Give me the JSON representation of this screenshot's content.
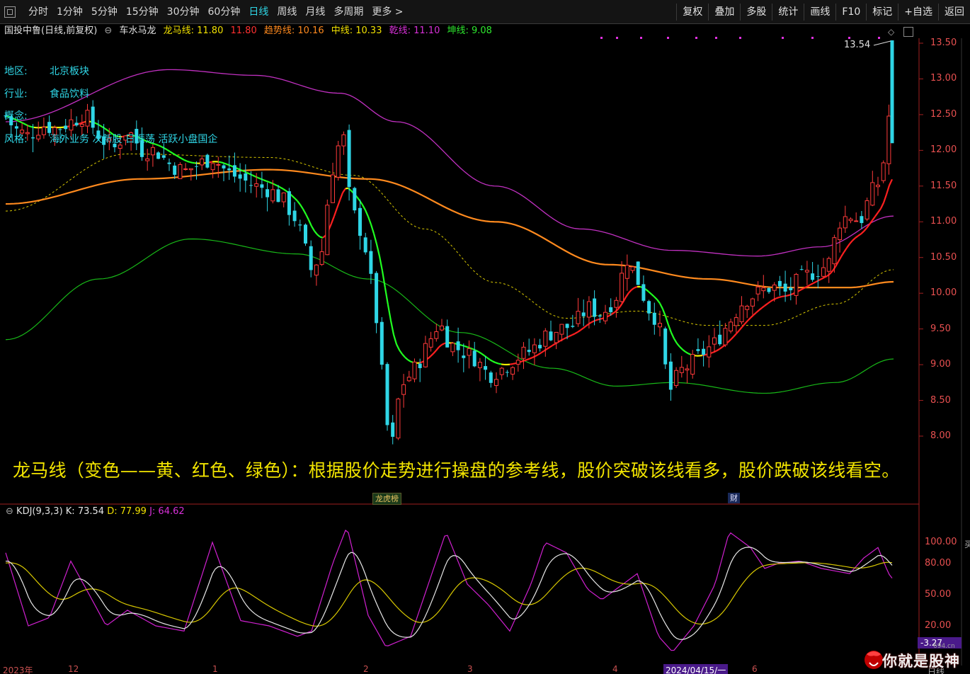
{
  "toolbar": {
    "periods": [
      "分时",
      "1分钟",
      "5分钟",
      "15分钟",
      "30分钟",
      "60分钟",
      "日线",
      "周线",
      "月线",
      "多周期",
      "更多 >"
    ],
    "active_period": "日线",
    "tools": [
      "复权",
      "叠加",
      "多股",
      "统计",
      "画线",
      "F10",
      "标记",
      "+自选",
      "返回"
    ]
  },
  "info": {
    "stock": "国投中鲁(日线,前复权)",
    "indicator_name": "车水马龙",
    "items": [
      {
        "label": "龙马线: 11.80",
        "color": "#f0e000"
      },
      {
        "label": "11.80",
        "color": "#ff3030"
      },
      {
        "label": "趋势线: 10.16",
        "color": "#ff8a1e"
      },
      {
        "label": "中线: 10.33",
        "color": "#f0e000"
      },
      {
        "label": "乾线: 11.10",
        "color": "#d830d8"
      },
      {
        "label": "坤线: 9.08",
        "color": "#2ee82e"
      }
    ]
  },
  "side": {
    "region_label": "地区:",
    "region_value": "北京板块",
    "industry_label": "行业:",
    "industry_value": "食品饮料",
    "concept_label": "概念:",
    "style_label": "风格:",
    "style_value": "海外业务 次新股 日振荡 活跃小盘国企"
  },
  "caption": "龙马线（变色——黄、红色、绿色）：根据股价走势进行操盘的参考线，股价突破该线看多，股价跌破该线看空。",
  "price_axis": [
    "13.50",
    "13.00",
    "12.50",
    "12.00",
    "11.50",
    "11.00",
    "10.50",
    "10.00",
    "9.50",
    "9.00",
    "8.50",
    "8.00"
  ],
  "max_price_label": "13.54",
  "kdj": {
    "label": "KDJ(9,3,3)",
    "k": "K: 73.54",
    "d": "D: 77.99",
    "j": "J: 64.62",
    "axis": [
      "100.00",
      "80.00",
      "50.00",
      "20.00"
    ],
    "current": "-3.27"
  },
  "badges": {
    "b1": "龙虎榜",
    "b2": "财"
  },
  "xaxis": [
    "2023年",
    "12",
    "1",
    "2",
    "3",
    "4",
    "2024/04/15/一",
    "6"
  ],
  "right_label_top": "买",
  "right_label_bottom": "日线",
  "watermark": {
    "text": "你就是股神",
    "site": "694.cn"
  },
  "colors": {
    "up": "#ff3a3a",
    "down": "#2fd6e6",
    "yellow": "#f0e000",
    "orange": "#ff8a1e",
    "purple": "#c030c0",
    "green": "#20c020",
    "white": "#e8e8e8"
  },
  "chart_data": {
    "type": "line",
    "title": "",
    "ylim": [
      7.6,
      13.7
    ],
    "series": [
      {
        "name": "龙马线",
        "value": 11.8
      },
      {
        "name": "趋势线",
        "value": 10.16
      },
      {
        "name": "中线",
        "value": 10.33
      },
      {
        "name": "乾线",
        "value": 11.1
      },
      {
        "name": "坤线",
        "value": 9.08
      }
    ],
    "max_label_value": 13.54,
    "kdj_ylim": [
      -5,
      115
    ]
  }
}
